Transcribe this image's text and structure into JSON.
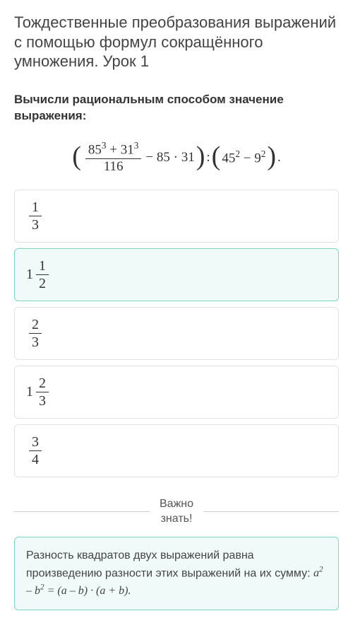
{
  "title": "Тождественные преобразования выражений с помощью формул сокращённого умножения. Урок 1",
  "prompt": "Вычисли рациональным способом значение выражения:",
  "expression": {
    "frac_num_a_base": "85",
    "frac_num_a_exp": "3",
    "frac_num_plus": " + ",
    "frac_num_b_base": "31",
    "frac_num_b_exp": "3",
    "frac_den": "116",
    "after_frac": " − 85 · 31",
    "between": " : ",
    "rhs_a_base": "45",
    "rhs_a_exp": "2",
    "rhs_minus": " − ",
    "rhs_b_base": "9",
    "rhs_b_exp": "2",
    "final": "."
  },
  "options": [
    {
      "whole": "",
      "num": "1",
      "den": "3",
      "selected": false
    },
    {
      "whole": "1",
      "num": "1",
      "den": "2",
      "selected": true
    },
    {
      "whole": "",
      "num": "2",
      "den": "3",
      "selected": false
    },
    {
      "whole": "1",
      "num": "2",
      "den": "3",
      "selected": false
    },
    {
      "whole": "",
      "num": "3",
      "den": "4",
      "selected": false
    }
  ],
  "divider_label": "Важно\nзнать!",
  "info": {
    "text": "Разность квадратов двух выражений равна произведению разности этих выражений на их сумму: ",
    "formula_a": "a",
    "formula_exp1": "2",
    "formula_minus": " – ",
    "formula_b": "b",
    "formula_exp2": "2",
    "formula_eq": " = (",
    "formula_a2": "a",
    "formula_minus2": " – ",
    "formula_b2": "b",
    "formula_mid": ") · (",
    "formula_a3": "a",
    "formula_plus": " + ",
    "formula_b3": "b",
    "formula_end": ")."
  }
}
